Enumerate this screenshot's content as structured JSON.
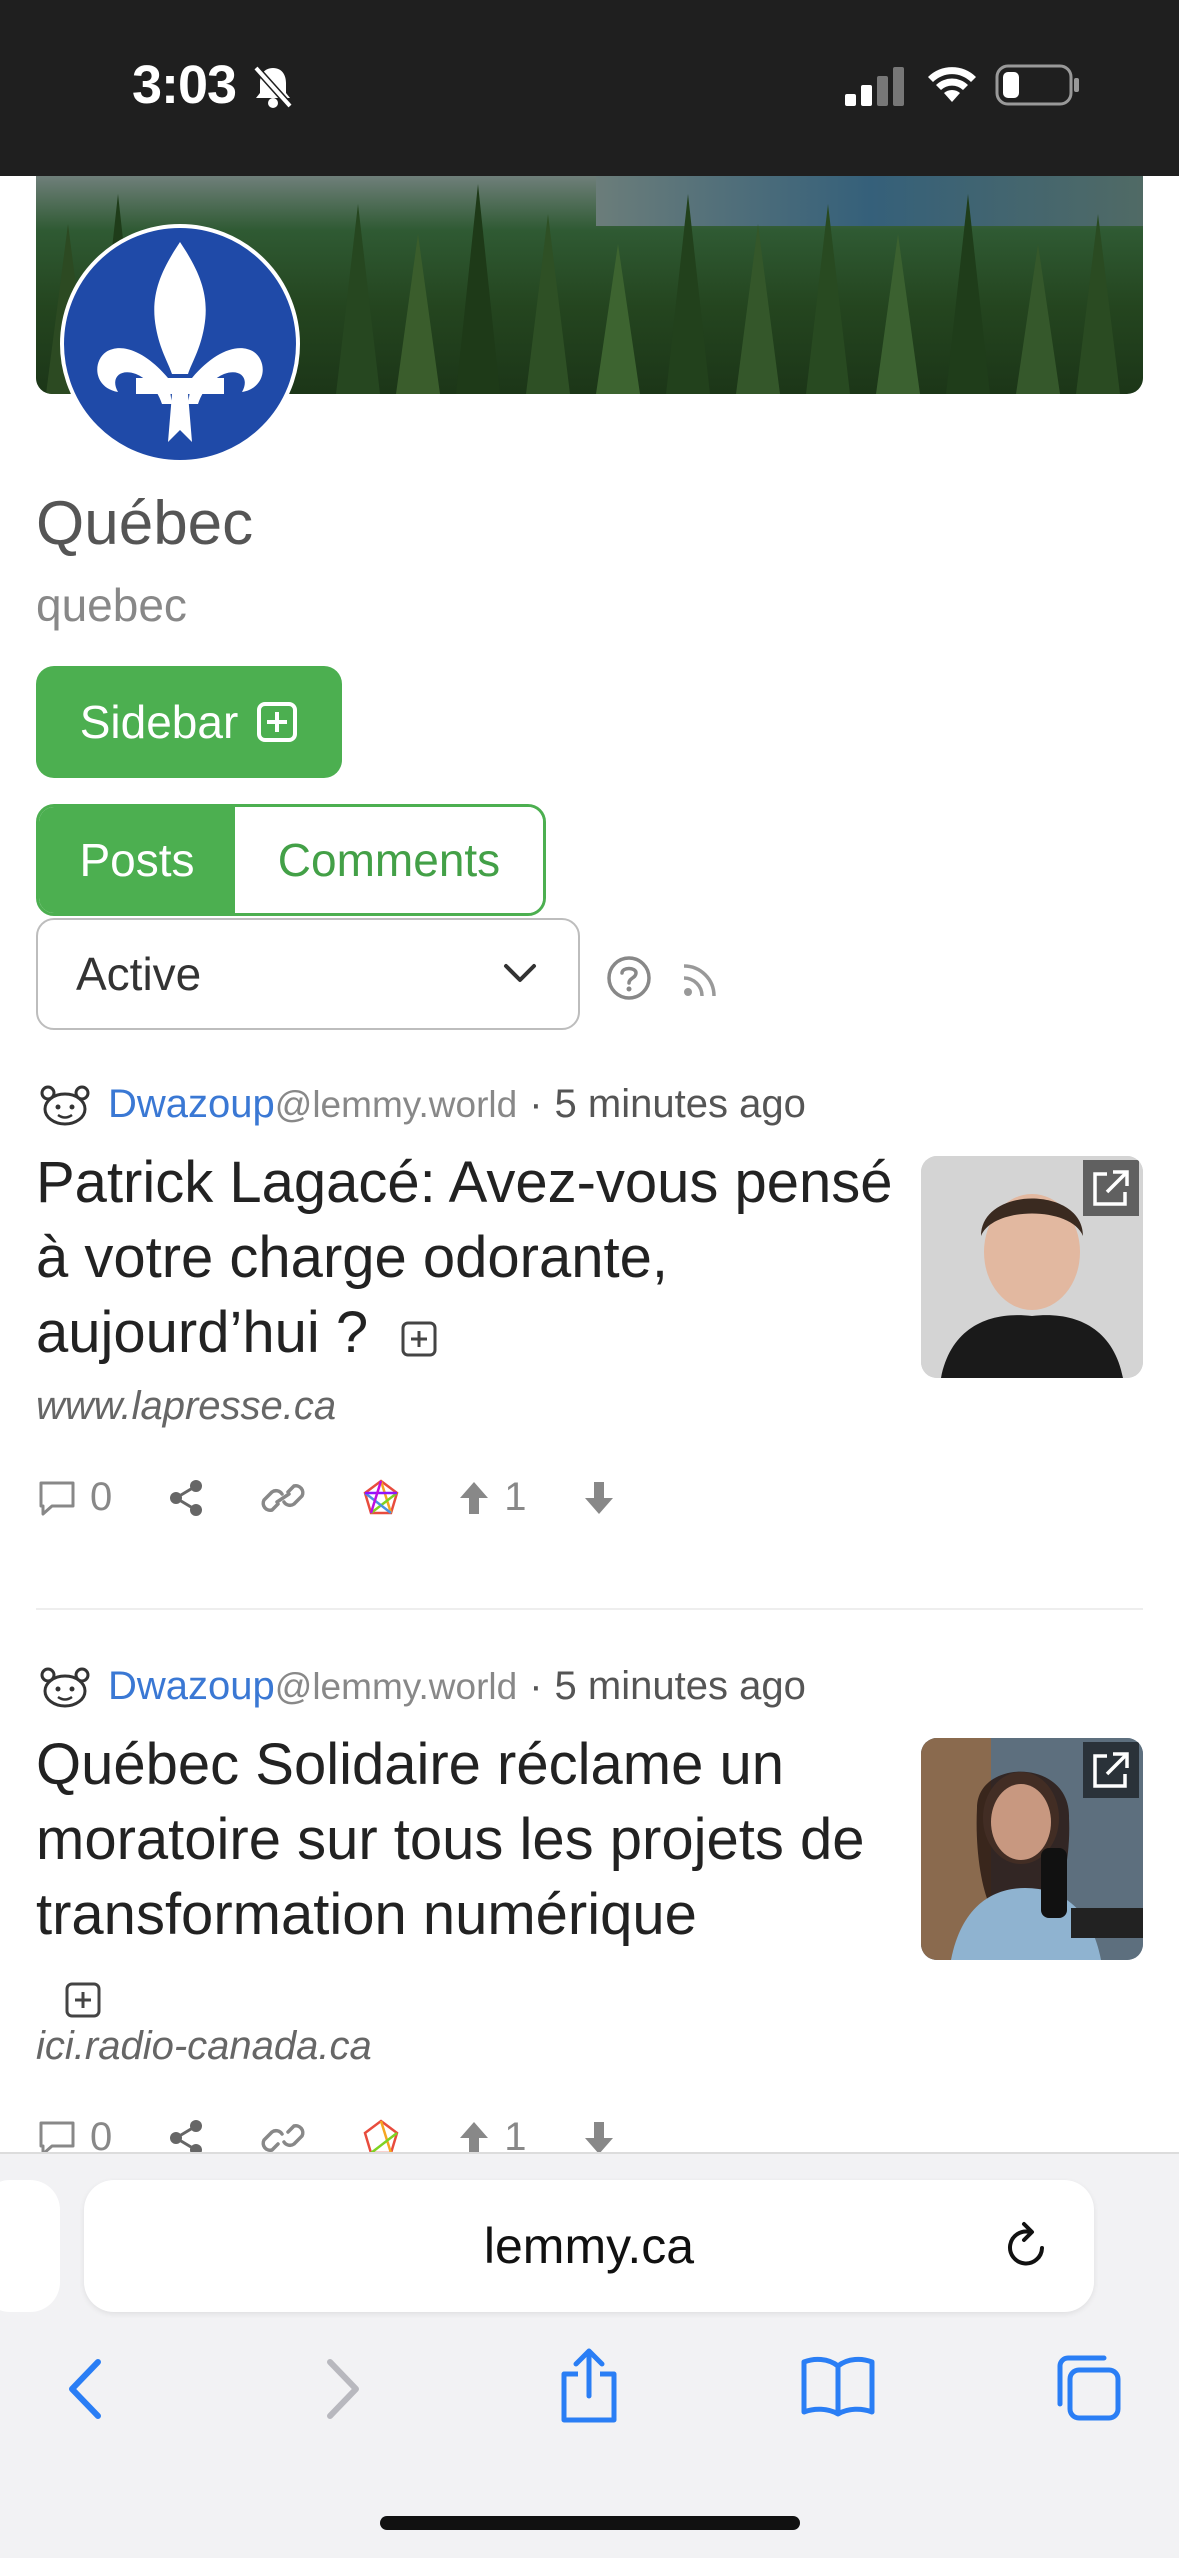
{
  "status_bar": {
    "time": "3:03"
  },
  "community": {
    "title": "Québec",
    "handle": "quebec",
    "sidebar_label": "Sidebar"
  },
  "tabs": [
    {
      "label": "Posts"
    },
    {
      "label": "Comments"
    }
  ],
  "sort": {
    "selected": "Active"
  },
  "posts": [
    {
      "author": "Dwazoup",
      "instance": "@lemmy.world",
      "time": "5 minutes ago",
      "title": "Patrick Lagacé: Avez-vous pensé à votre charge odorante, aujourd’hui ?",
      "domain": "www.lapresse.ca",
      "comments": "0",
      "score": "1"
    },
    {
      "author": "Dwazoup",
      "instance": "@lemmy.world",
      "time": "5 minutes ago",
      "title": "Québec Solidaire réclame un moratoire sur tous les projets de transformation numérique",
      "domain": "ici.radio-canada.ca",
      "comments": "0",
      "score": "1"
    }
  ],
  "browser": {
    "url": "lemmy.ca"
  },
  "colors": {
    "accent": "#4caf50",
    "link": "#3a78d4",
    "flag_blue": "#1f4aa8"
  }
}
